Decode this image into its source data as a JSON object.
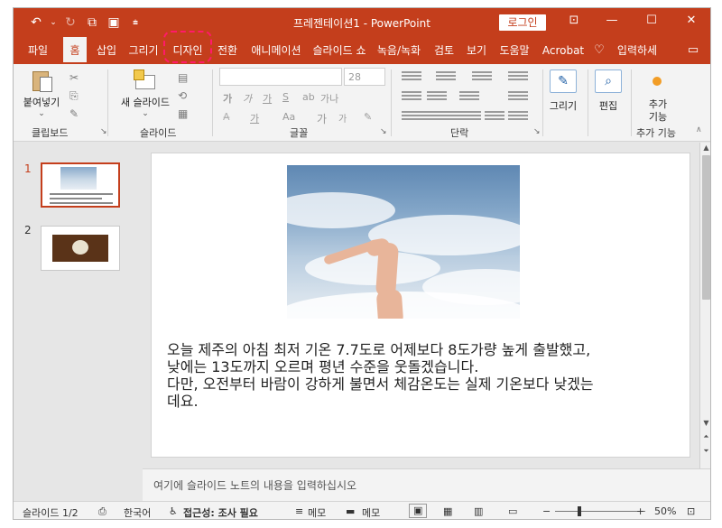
{
  "titlebar": {
    "title": "프레젠테이션1  -  PowerPoint",
    "login": "로그인",
    "qat_icons": [
      "undo-icon",
      "redo-icon",
      "from-beginning-icon",
      "save-icon",
      "customize-icon"
    ]
  },
  "tabs": [
    {
      "label": "파일"
    },
    {
      "label": "홈"
    },
    {
      "label": "삽입"
    },
    {
      "label": "그리기"
    },
    {
      "label": "디자인"
    },
    {
      "label": "전환"
    },
    {
      "label": "애니메이션"
    },
    {
      "label": "슬라이드 쇼"
    },
    {
      "label": "녹음/녹화"
    },
    {
      "label": "검토"
    },
    {
      "label": "보기"
    },
    {
      "label": "도움말"
    },
    {
      "label": "Acrobat"
    },
    {
      "label": "입력하세"
    }
  ],
  "ribbon": {
    "paste": "붙여넣기",
    "clipboard": "클립보드",
    "new_slide": "새 슬라이드",
    "slides": "슬라이드",
    "font": "글꼴",
    "font_size": "28",
    "paragraph": "단락",
    "draw": "그리기",
    "edit": "편집",
    "addins": "추가\n기능",
    "addins_group": "추가 기능",
    "fmt_bold": "가",
    "fmt_italic": "가",
    "fmt_underline": "가",
    "fmt_strike": "S",
    "fmt_spacing": "가나",
    "fmt_aa": "Aa",
    "fmt_grow": "가",
    "fmt_shrink": "가"
  },
  "thumbnails": [
    {
      "num": "1"
    },
    {
      "num": "2"
    }
  ],
  "slide": {
    "lines": [
      "오늘 제주의 아침 최저 기온 7.7도로 어제보다 8도가량 높게 출발했고,",
      "낮에는 13도까지 오르며 평년 수준을 웃돌겠습니다.",
      "다만, 오전부터 바람이 강하게 불면서 체감온도는 실제 기온보다 낮겠는",
      "데요."
    ]
  },
  "notes_placeholder": "여기에 슬라이드 노트의 내용을 입력하십시오",
  "status": {
    "slide_count": "슬라이드 1/2",
    "language": "한국어",
    "accessibility": "접근성: 조사 필요",
    "notes": "메모",
    "comments": "메모",
    "zoom": "50%"
  },
  "colors": {
    "accent": "#c43e1c",
    "highlight": "#ff1a6a"
  }
}
